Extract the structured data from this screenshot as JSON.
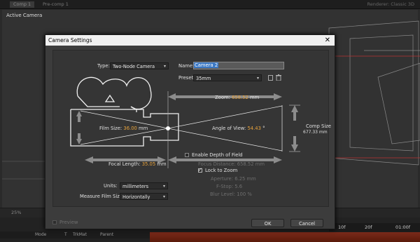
{
  "app": {
    "tabs": [
      "Comp 1",
      "Pre-comp 1"
    ],
    "renderer": "Renderer:  Classic 3D",
    "viewer_label": "Active Camera",
    "zoom": "25%",
    "timeline": {
      "columns": [
        "Mode",
        "T",
        "TrkMat",
        "Parent"
      ],
      "ticks": [
        "10f",
        "20f",
        "01:00f"
      ]
    }
  },
  "dialog": {
    "title": "Camera Settings",
    "type_label": "Type:",
    "type_value": "Two-Node Camera",
    "name_label": "Name:",
    "name_value": "Camera 2",
    "preset_label": "Preset:",
    "preset_value": "35mm",
    "zoom_label": "Zoom:",
    "zoom_value": "658.52",
    "zoom_unit": "mm",
    "film_size_label": "Film Size:",
    "film_size_value": "36.00",
    "film_size_unit": "mm",
    "angle_label": "Angle of View:",
    "angle_value": "54.43",
    "angle_unit": "°",
    "comp_size_label": "Comp Size",
    "comp_size_value": "677.33 mm",
    "dof_label": "Enable Depth of Field",
    "dof_checked": false,
    "focal_length_label": "Focal Length:",
    "focal_length_value": "35.05",
    "focal_length_unit": "mm",
    "focus_distance_label": "Focus Distance:",
    "focus_distance_value": "658.52",
    "focus_distance_unit": "mm",
    "lock_zoom_label": "Lock to Zoom",
    "lock_zoom_checked": true,
    "aperture_label": "Aperture:",
    "aperture_value": "6.25",
    "aperture_unit": "mm",
    "fstop_label": "F-Stop:",
    "fstop_value": "5.6",
    "blur_label": "Blur Level:",
    "blur_value": "100",
    "blur_unit": "%",
    "units_label": "Units:",
    "units_value": "millimeters",
    "measure_label": "Measure Film Size:",
    "measure_value": "Horizontally",
    "preview_label": "Preview",
    "ok_label": "OK",
    "cancel_label": "Cancel",
    "check_mark": "✓",
    "close_glyph": "✕",
    "dropdown_arrow": "▾",
    "trash_icon": "trash-icon",
    "preset_save_icon": "save-preset-icon"
  }
}
